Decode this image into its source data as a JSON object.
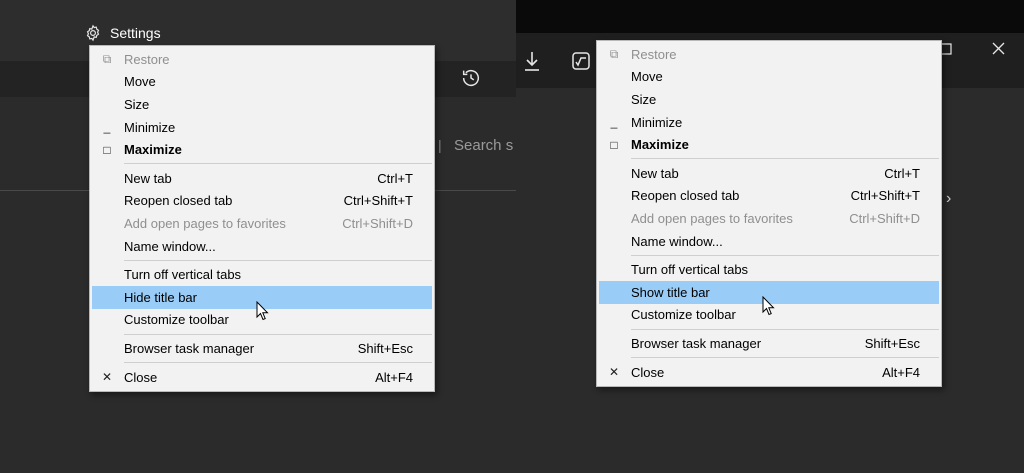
{
  "left": {
    "window_title": "Settings",
    "search_text": "Search s",
    "menu": {
      "items": [
        {
          "glyph": "⧉",
          "label": "Restore",
          "shortcut": "",
          "disabled": true
        },
        {
          "glyph": "",
          "label": "Move",
          "shortcut": ""
        },
        {
          "glyph": "",
          "label": "Size",
          "shortcut": ""
        },
        {
          "glyph": "_",
          "label": "Minimize",
          "shortcut": ""
        },
        {
          "glyph": "□",
          "label": "Maximize",
          "shortcut": "",
          "bold": true
        },
        {
          "separator": true
        },
        {
          "glyph": "",
          "label": "New tab",
          "shortcut": "Ctrl+T"
        },
        {
          "glyph": "",
          "label": "Reopen closed tab",
          "shortcut": "Ctrl+Shift+T"
        },
        {
          "glyph": "",
          "label": "Add open pages to favorites",
          "shortcut": "Ctrl+Shift+D",
          "disabled": true
        },
        {
          "glyph": "",
          "label": "Name window...",
          "shortcut": ""
        },
        {
          "separator": true
        },
        {
          "glyph": "",
          "label": "Turn off vertical tabs",
          "shortcut": ""
        },
        {
          "glyph": "",
          "label": "Hide title bar",
          "shortcut": "",
          "highlighted": true
        },
        {
          "glyph": "",
          "label": "Customize toolbar",
          "shortcut": ""
        },
        {
          "separator": true
        },
        {
          "glyph": "",
          "label": "Browser task manager",
          "shortcut": "Shift+Esc"
        },
        {
          "separator": true
        },
        {
          "glyph": "✕",
          "label": "Close",
          "shortcut": "Alt+F4"
        }
      ]
    }
  },
  "right": {
    "menu": {
      "items": [
        {
          "glyph": "⧉",
          "label": "Restore",
          "shortcut": "",
          "disabled": true
        },
        {
          "glyph": "",
          "label": "Move",
          "shortcut": ""
        },
        {
          "glyph": "",
          "label": "Size",
          "shortcut": ""
        },
        {
          "glyph": "_",
          "label": "Minimize",
          "shortcut": ""
        },
        {
          "glyph": "□",
          "label": "Maximize",
          "shortcut": "",
          "bold": true
        },
        {
          "separator": true
        },
        {
          "glyph": "",
          "label": "New tab",
          "shortcut": "Ctrl+T"
        },
        {
          "glyph": "",
          "label": "Reopen closed tab",
          "shortcut": "Ctrl+Shift+T"
        },
        {
          "glyph": "",
          "label": "Add open pages to favorites",
          "shortcut": "Ctrl+Shift+D",
          "disabled": true
        },
        {
          "glyph": "",
          "label": "Name window...",
          "shortcut": ""
        },
        {
          "separator": true
        },
        {
          "glyph": "",
          "label": "Turn off vertical tabs",
          "shortcut": ""
        },
        {
          "glyph": "",
          "label": "Show title bar",
          "shortcut": "",
          "highlighted": true
        },
        {
          "glyph": "",
          "label": "Customize toolbar",
          "shortcut": ""
        },
        {
          "separator": true
        },
        {
          "glyph": "",
          "label": "Browser task manager",
          "shortcut": "Shift+Esc"
        },
        {
          "separator": true
        },
        {
          "glyph": "✕",
          "label": "Close",
          "shortcut": "Alt+F4"
        }
      ]
    }
  },
  "colors": {
    "highlight": "#99ccf7",
    "menu_bg": "#f2f2f2",
    "disabled_text": "#8f8f8f"
  },
  "icons": {
    "settings": "gear-icon",
    "history": "history-icon",
    "download": "download-icon",
    "math_solver": "math-solver-icon",
    "maximize": "maximize-icon",
    "close": "close-icon"
  }
}
